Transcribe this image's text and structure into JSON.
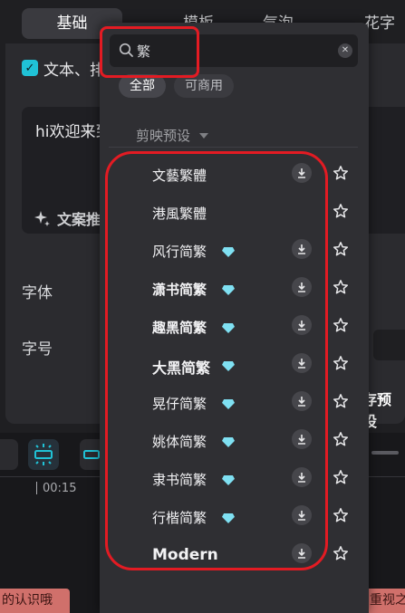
{
  "editor": {
    "tabs": [
      {
        "label": "基础"
      },
      {
        "label": "模板"
      },
      {
        "label": "气泡"
      },
      {
        "label": "花字"
      }
    ],
    "checkbox_label": "文本、排",
    "text_content": "hi欢迎来到",
    "ai_button_label": "文案推",
    "font_label": "字体",
    "size_label": "字号",
    "save_preset_label": "存预设"
  },
  "timeline": {
    "time": "00:15",
    "clip_left_text": "的认识哦",
    "clip_right_text": "重视之"
  },
  "font_picker": {
    "search": {
      "value": "繁",
      "placeholder": ""
    },
    "filters": [
      {
        "label": "全部",
        "active": true
      },
      {
        "label": "可商用",
        "active": false
      }
    ],
    "category_label": "剪映预设",
    "fonts": [
      {
        "name": "文藝繁體",
        "premium": false,
        "downloadable": true
      },
      {
        "name": "港風繁體",
        "premium": false,
        "downloadable": false
      },
      {
        "name": "风行简繁",
        "premium": true,
        "downloadable": true
      },
      {
        "name": "潇书简繁",
        "premium": true,
        "downloadable": true
      },
      {
        "name": "趣黑简繁",
        "premium": true,
        "downloadable": true
      },
      {
        "name": "大黑简繁",
        "premium": true,
        "downloadable": true
      },
      {
        "name": "晃仔简繁",
        "premium": true,
        "downloadable": true
      },
      {
        "name": "姚体简繁",
        "premium": true,
        "downloadable": true
      },
      {
        "name": "隶书简繁",
        "premium": true,
        "downloadable": true
      },
      {
        "name": "行楷简繁",
        "premium": true,
        "downloadable": true
      },
      {
        "name": "Modern",
        "premium": false,
        "downloadable": true
      }
    ]
  },
  "colors": {
    "accent": "#20c2d6",
    "highlight": "#e31b23",
    "premium_gem": "#7fe0f2",
    "clip": "#d0706b"
  }
}
